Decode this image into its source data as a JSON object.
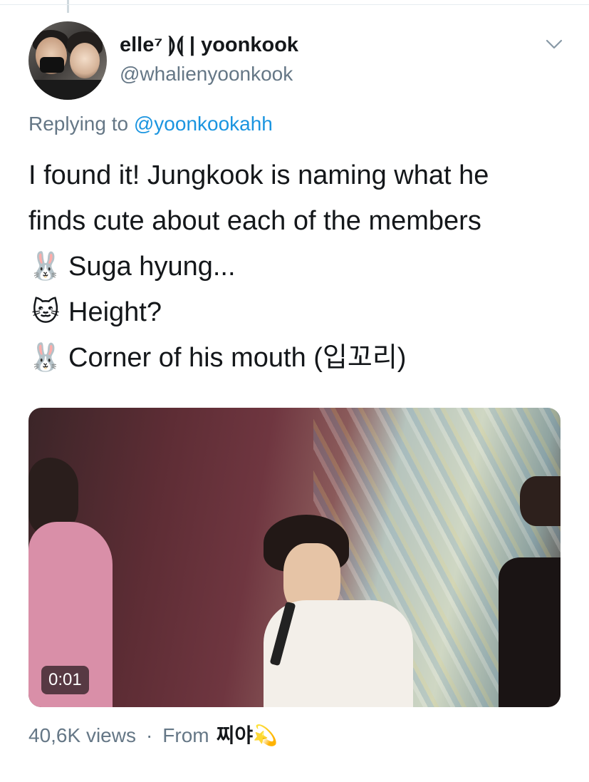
{
  "tweet": {
    "author": {
      "display_name": "elle⁷ ⟭⟬ | yoonkook",
      "handle": "@whalienyoonkook"
    },
    "reply": {
      "prefix": "Replying to",
      "mention": "@yoonkookahh"
    },
    "text_lines": [
      {
        "emoji": "",
        "text": "I found it! Jungkook is naming what he"
      },
      {
        "emoji": "",
        "text": "finds cute about each of the members"
      },
      {
        "emoji": "🐰",
        "text": "Suga hyung..."
      },
      {
        "emoji": "🐱",
        "text": "Height?"
      },
      {
        "emoji": "🐰",
        "text": "Corner of his mouth (입꼬리)"
      }
    ],
    "media": {
      "duration": "0:01"
    },
    "meta": {
      "views": "40,6K views",
      "separator": "·",
      "from_label": "From",
      "source_name": "찌야",
      "source_emoji": "💫"
    }
  },
  "colors": {
    "text_primary": "#14171a",
    "text_secondary": "#657786",
    "link": "#1b95e0"
  }
}
